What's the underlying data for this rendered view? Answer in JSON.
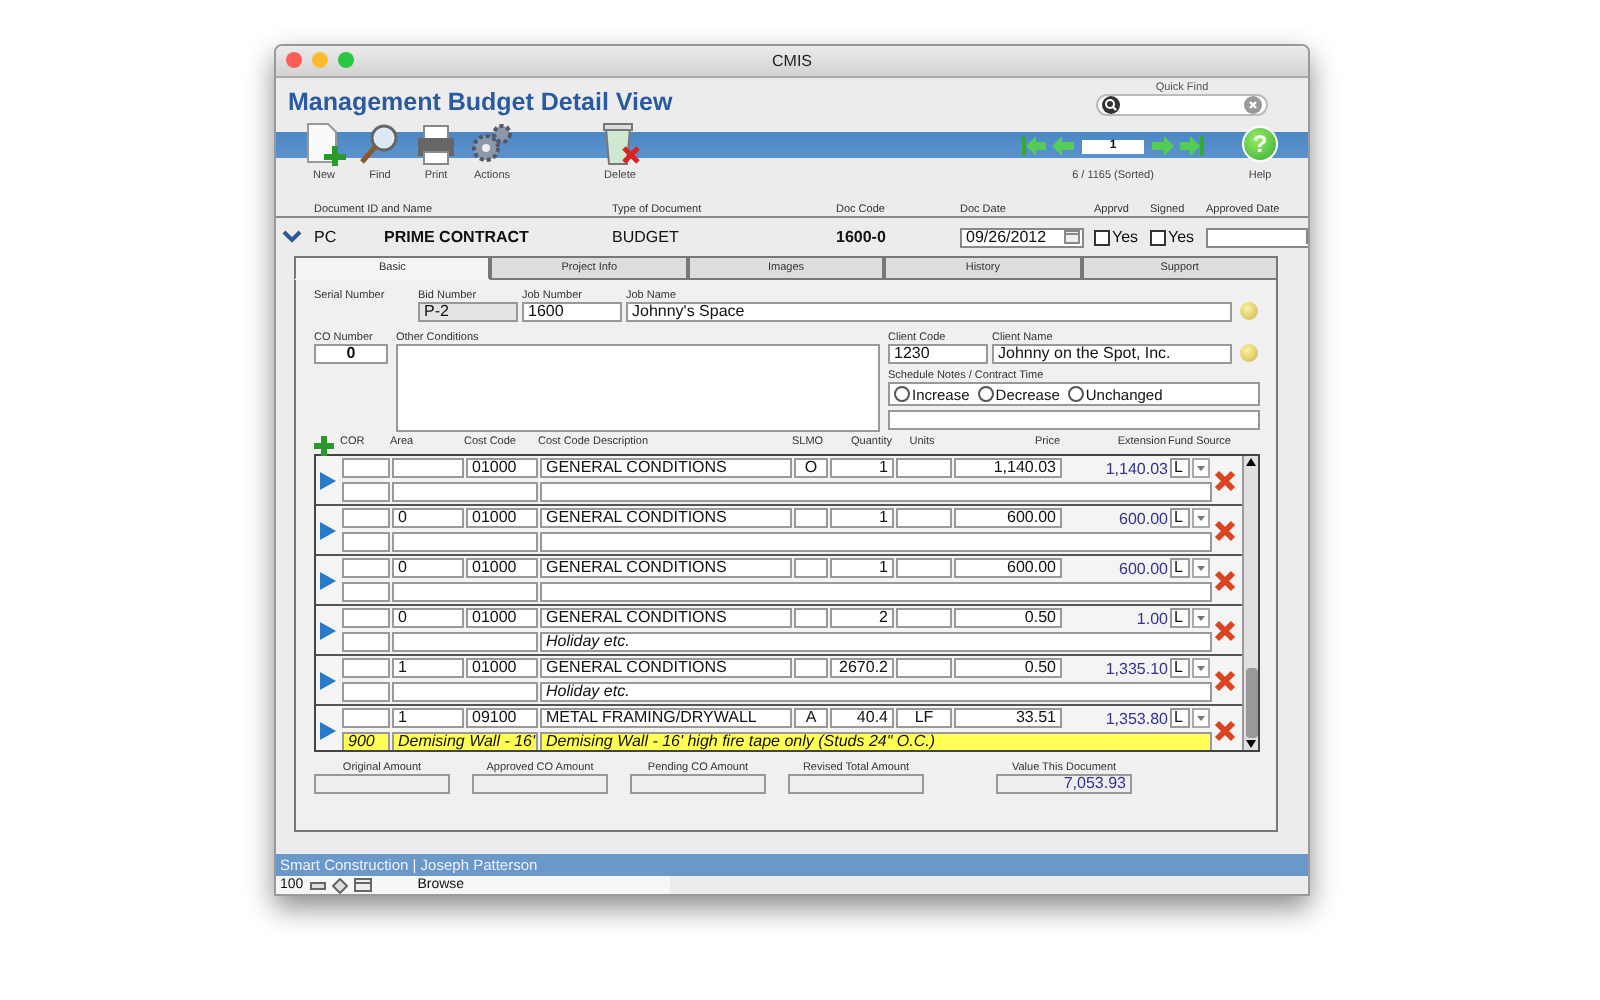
{
  "window": {
    "title": "CMIS"
  },
  "header": {
    "title": "Management Budget Detail View",
    "quick_find": {
      "label": "Quick Find"
    }
  },
  "toolbar": {
    "buttons": [
      {
        "label": "New",
        "kind": "new"
      },
      {
        "label": "Find",
        "kind": "find"
      },
      {
        "label": "Print",
        "kind": "print"
      },
      {
        "label": "Actions",
        "kind": "actions"
      },
      {
        "label": "Delete",
        "kind": "delete"
      }
    ],
    "record": {
      "value": "1",
      "count": "6 / 1165 (Sorted)"
    },
    "help": {
      "symbol": "?",
      "label": "Help"
    }
  },
  "document": {
    "headers": [
      "Document ID and Name",
      "Type of Document",
      "Doc Code",
      "Doc Date",
      "Apprvd",
      "Signed",
      "Approved Date"
    ],
    "id": "PC",
    "name": "PRIME CONTRACT",
    "type": "BUDGET",
    "code": "1600-0",
    "date": "09/26/2012",
    "approved": {
      "label": "Yes",
      "checked": false
    },
    "signed": {
      "label": "Yes",
      "checked": false
    }
  },
  "tabs": [
    {
      "label": "Basic",
      "selected": true
    },
    {
      "label": "Project Info",
      "selected": false
    },
    {
      "label": "Images",
      "selected": false
    },
    {
      "label": "History",
      "selected": false
    },
    {
      "label": "Support",
      "selected": false
    }
  ],
  "form": {
    "serial_number": {
      "label": "Serial Number"
    },
    "bid_number": {
      "label": "Bid Number",
      "value": "P-2"
    },
    "job_number": {
      "label": "Job Number",
      "value": "1600"
    },
    "job_name": {
      "label": "Job Name",
      "value": "Johnny's Space"
    },
    "co_number": {
      "label": "CO Number",
      "value": "0"
    },
    "other_conditions": {
      "label": "Other Conditions"
    },
    "client_code": {
      "label": "Client Code",
      "value": "1230"
    },
    "client_name": {
      "label": "Client Name",
      "value": "Johnny on the Spot, Inc."
    },
    "schedule": {
      "label": "Schedule Notes / Contract Time",
      "options": [
        {
          "label": "Increase",
          "selected": false
        },
        {
          "label": "Decrease",
          "selected": false
        },
        {
          "label": "Unchanged",
          "selected": false
        }
      ]
    }
  },
  "lines": {
    "columns": [
      "COR",
      "Area",
      "Cost Code",
      "Cost Code Description",
      "SLMO",
      "Quantity",
      "Units",
      "Price",
      "Extension",
      "Fund Source"
    ],
    "rows": [
      {
        "cost_code": "01000",
        "description": "GENERAL CONDITIONS",
        "slmo": "O",
        "quantity": "1",
        "price": "1,140.03",
        "extension": "1,140.03",
        "fund": "L",
        "highlighted": false
      },
      {
        "area": "0",
        "cost_code": "01000",
        "description": "GENERAL CONDITIONS",
        "quantity": "1",
        "price": "600.00",
        "extension": "600.00",
        "fund": "L",
        "highlighted": false
      },
      {
        "area": "0",
        "cost_code": "01000",
        "description": "GENERAL CONDITIONS",
        "quantity": "1",
        "price": "600.00",
        "extension": "600.00",
        "fund": "L",
        "highlighted": false
      },
      {
        "area": "0",
        "cost_code": "01000",
        "description": "GENERAL CONDITIONS",
        "quantity": "2",
        "price": "0.50",
        "extension": "1.00",
        "fund": "L",
        "note": "Holiday etc.",
        "highlighted": false
      },
      {
        "area": "1",
        "cost_code": "01000",
        "description": "GENERAL CONDITIONS",
        "quantity": "2670.2",
        "price": "0.50",
        "extension": "1,335.10",
        "fund": "L",
        "note": "Holiday etc.",
        "highlighted": false
      },
      {
        "area": "1",
        "cost_code": "09100",
        "description": "METAL FRAMING/DRYWALL",
        "slmo": "A",
        "quantity": "40.4",
        "units": "LF",
        "price": "33.51",
        "extension": "1,353.80",
        "fund": "L",
        "cor_2": "900",
        "area_2": "Demising Wall - 16'",
        "note": "Demising Wall - 16' high fire tape only (Studs 24\" O.C.)",
        "highlighted": true
      }
    ]
  },
  "totals": [
    {
      "label": "Original Amount"
    },
    {
      "label": "Approved CO Amount"
    },
    {
      "label": "Pending CO Amount"
    },
    {
      "label": "Revised Total Amount"
    },
    {
      "label": "Value This Document",
      "value": "7,053.93"
    }
  ],
  "status_bar": {
    "text": "Smart Construction | Joseph Patterson",
    "zoom": "100",
    "mode": "Browse"
  }
}
